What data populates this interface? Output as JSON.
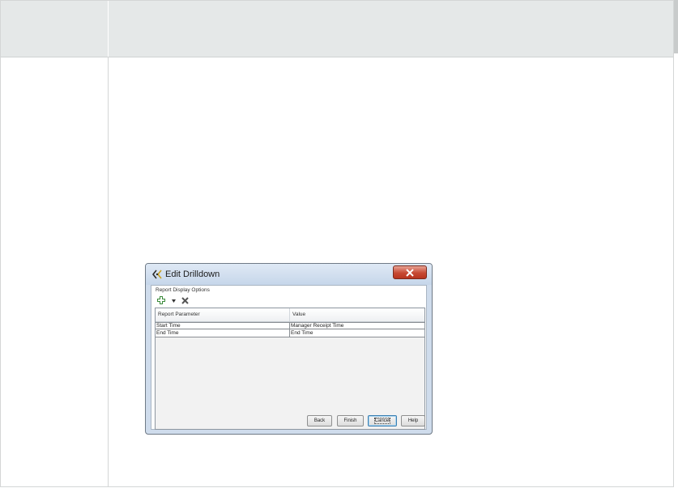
{
  "dialog": {
    "title": "Edit Drilldown",
    "section_label": "Report Display Options",
    "grid": {
      "columns": [
        "Report Parameter",
        "Value"
      ],
      "rows": [
        [
          "Start Time",
          "Manager Receipt Time"
        ],
        [
          "End Time",
          "End Time"
        ]
      ]
    },
    "buttons": {
      "back": "Back",
      "finish": "Finish",
      "cancel": "Cancel",
      "help": "Help"
    },
    "icons": {
      "app": "drilldown-app-icon",
      "close": "close-icon",
      "add": "add-icon",
      "dropdown": "chevron-down-icon",
      "delete": "delete-icon"
    },
    "colors": {
      "close_button": "#c74a34",
      "titlebar": "#cfdcec",
      "header_band": "#e5e8e8"
    }
  }
}
